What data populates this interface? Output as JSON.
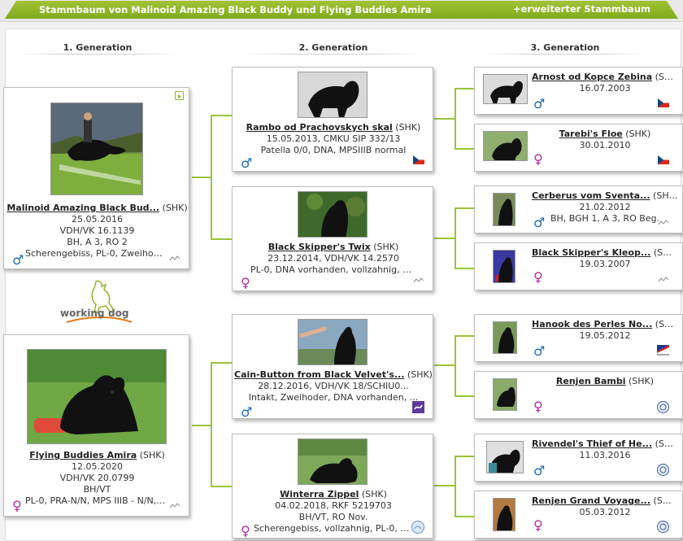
{
  "title": "Stammbaum von Malinoid Amazing Black Buddy und Flying Buddies Amira",
  "extended_link": "+erweiterter Stammbaum",
  "generations": [
    "1. Generation",
    "2. Generation",
    "3. Generation"
  ],
  "logo": {
    "word1": "working",
    "word2": "dog"
  },
  "gen1": [
    {
      "name": "Malinoid Amazing Black Bud...",
      "breed": "(SHK)",
      "lines": [
        "25.05.2016",
        "VDH/VK 16.1139",
        "BH, A 3, RO 2",
        "Scherengebiss, PL-0, Zweihode..."
      ],
      "sex": "♂",
      "sex_type": "male"
    },
    {
      "name": "Flying Buddies Amira",
      "breed": "(SHK)",
      "lines": [
        "12.05.2020",
        "VDH/VK 20.0799",
        "BH/VT",
        "PL-0, PRA-N/N, MPS IIIB - N/N, ..."
      ],
      "sex": "♀",
      "sex_type": "female"
    }
  ],
  "gen2": [
    {
      "name": "Rambo od Prachovskych skal",
      "breed": "(SHK)",
      "lines": [
        "15.05.2013, CMKU SIP 332/13",
        "Patella 0/0, DNA, MPSIIIB normal"
      ],
      "sex": "♂",
      "sex_type": "male"
    },
    {
      "name": "Black Skipper's Twix",
      "breed": "(SHK)",
      "lines": [
        "23.12.2014, VDH/VK 14.2570",
        "PL-0, DNA vorhanden, vollzahnig, Sc..."
      ],
      "sex": "♀",
      "sex_type": "female"
    },
    {
      "name": "Cain-Button from Black Velvet's...",
      "breed": "(SHK)",
      "lines": [
        "28.12.2016, VDH/VK 18/SCHIU0...",
        "Intakt, Zweihoder, DNA vorhanden, ..."
      ],
      "sex": "♂",
      "sex_type": "male"
    },
    {
      "name": "Winterra Zippel",
      "breed": "(SHK)",
      "lines": [
        "04.02.2018, RKF 5219703",
        "BH/VT, RO Nov.",
        "Scherengebiss, vollzahnig, PL-0, Kas..."
      ],
      "sex": "♀",
      "sex_type": "female"
    }
  ],
  "gen3": [
    {
      "name": "Arnost od Kopce Zebina",
      "breed": "(SHK)",
      "lines": [
        "16.07.2003"
      ],
      "sex": "♂",
      "sex_type": "male"
    },
    {
      "name": "Tarebi's Floe",
      "breed": "(SHK)",
      "lines": [
        "30.01.2010"
      ],
      "sex": "♀",
      "sex_type": "female"
    },
    {
      "name": "Cerberus vom Sventa...",
      "breed": "(SHK)",
      "lines": [
        "21.02.2012",
        "BH, BGH 1, A 3, RO Beg."
      ],
      "sex": "♂",
      "sex_type": "male"
    },
    {
      "name": "Black Skipper's Kleop...",
      "breed": "(SHK)",
      "lines": [
        "19.03.2007"
      ],
      "sex": "♀",
      "sex_type": "female"
    },
    {
      "name": "Hanook des Perles No...",
      "breed": "(SHK)",
      "lines": [
        "19.05.2012"
      ],
      "sex": "♂",
      "sex_type": "male"
    },
    {
      "name": "Renjen Bambi",
      "breed": "(SHK)",
      "lines": [],
      "sex": "♀",
      "sex_type": "female"
    },
    {
      "name": "Rivendel's Thief of He...",
      "breed": "(SHK)",
      "lines": [
        "11.03.2016"
      ],
      "sex": "♂",
      "sex_type": "male"
    },
    {
      "name": "Renjen Grand Voyage...",
      "breed": "(SHK)",
      "lines": [
        "05.03.2012"
      ],
      "sex": "♀",
      "sex_type": "female"
    }
  ],
  "colors": {
    "accent": "#8db528",
    "male": "#1a6ab0",
    "female": "#b02a9a"
  }
}
